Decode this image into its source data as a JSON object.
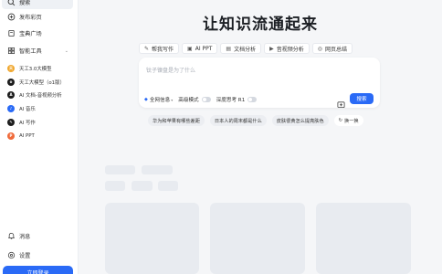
{
  "sidebar": {
    "items": [
      {
        "label": "搜索",
        "icon": "search-icon"
      },
      {
        "label": "发布彩页",
        "icon": "plus-circle-icon"
      },
      {
        "label": "宝典广场",
        "icon": "book-icon"
      },
      {
        "label": "智能工具",
        "icon": "grid-icon"
      }
    ],
    "tools": [
      {
        "label": "天工3.0大模型",
        "icon": "tiangong-logo-icon",
        "color": "#f0a830"
      },
      {
        "label": "天工大模型（o1版）",
        "icon": "tiangong-o1-logo-icon",
        "color": "#1c1c1c"
      },
      {
        "label": "AI 文档-音视频分析",
        "icon": "doc-analysis-icon",
        "color": "#1c1c1c"
      },
      {
        "label": "AI 音乐",
        "icon": "music-icon",
        "color": "#2a6af6"
      },
      {
        "label": "AI 写作",
        "icon": "writing-icon",
        "color": "#1c1c1c"
      },
      {
        "label": "AI PPT",
        "icon": "ppt-icon",
        "color": "#f06a3a"
      }
    ],
    "bottom": [
      {
        "label": "消息",
        "icon": "bell-icon"
      },
      {
        "label": "设置",
        "icon": "gear-icon"
      }
    ],
    "login_label": "立即登录"
  },
  "main": {
    "title": "让知识流通起来",
    "tabs": [
      {
        "label": "帮我写作",
        "icon": "pen-icon"
      },
      {
        "label": "AI PPT",
        "icon": "ppt-icon"
      },
      {
        "label": "文档分析",
        "icon": "document-icon"
      },
      {
        "label": "音视频分析",
        "icon": "video-icon"
      },
      {
        "label": "网页总结",
        "icon": "web-icon"
      }
    ],
    "search": {
      "placeholder": "钛子镍盘是为了什么",
      "options": [
        {
          "label": "全网信息",
          "icon": "globe-icon"
        },
        {
          "label": "高级模式",
          "toggle": false
        },
        {
          "label": "深度思考 R1",
          "toggle": false
        }
      ],
      "button_label": "搜索"
    },
    "suggestions": [
      "华为和苹果有哪些差距",
      "日本人的周末都是什么",
      "皮肤很黄怎么提亮肤色"
    ],
    "refresh_label": "换一换"
  },
  "colors": {
    "accent": "#2a6af6",
    "skeleton": "#e8ebf0",
    "background": "#f5f6f8"
  }
}
